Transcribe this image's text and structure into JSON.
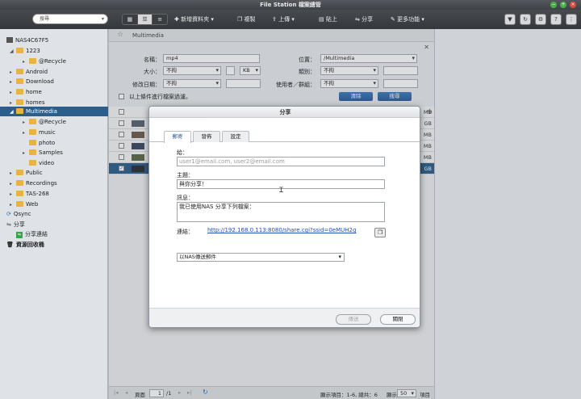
{
  "window": {
    "title": "File Station 檔案總管"
  },
  "toolbar": {
    "search_placeholder": "搜尋",
    "new_folder": "新增資料夾",
    "copy": "複製",
    "upload": "上傳",
    "paste": "貼上",
    "share": "分享",
    "more": "更多功能"
  },
  "sidebar": {
    "nas_name": "NAS4C67F5",
    "items": [
      {
        "label": "1223"
      },
      {
        "label": "@Recycle"
      },
      {
        "label": "Android"
      },
      {
        "label": "Download"
      },
      {
        "label": "home"
      },
      {
        "label": "homes"
      },
      {
        "label": "Multimedia"
      },
      {
        "label": "@Recycle"
      },
      {
        "label": "music"
      },
      {
        "label": "photo"
      },
      {
        "label": "Samples"
      },
      {
        "label": "video"
      },
      {
        "label": "Public"
      },
      {
        "label": "Recordings"
      },
      {
        "label": "TAS-268"
      },
      {
        "label": "Web"
      }
    ],
    "qsync": "Qsync",
    "share": "分享",
    "share_link": "分享連結",
    "recycle": "資源回收桶"
  },
  "path": {
    "current": "Multimedia"
  },
  "filter": {
    "name_label": "名稱：",
    "name_value": "mp4",
    "location_label": "位置：",
    "location_value": "/Multimedia",
    "size_label": "大小：",
    "size_value": "不拘",
    "size_unit": "KB",
    "type_label": "類別：",
    "type_value": "不拘",
    "modified_label": "修改日期：",
    "modified_value": "不拘",
    "owner_label": "使用者／群組：",
    "owner_value": "不拘",
    "clear_btn": "清除",
    "search_btn": "搜尋",
    "apply_label": "以上條件進行檔案過濾。"
  },
  "rows": [
    {
      "size": "MB"
    },
    {
      "size": "GB"
    },
    {
      "size": "MB"
    },
    {
      "size": "MB"
    },
    {
      "size": "MB"
    },
    {
      "size": "GB"
    }
  ],
  "pager": {
    "page_label": "頁面",
    "page_value": "1",
    "page_total": "/1",
    "display": "顯示項目：1-6, 總共：6",
    "show_label": "顯示",
    "show_value": "50",
    "items": "項目"
  },
  "dialog": {
    "title": "分享",
    "tabs": [
      "郵寄",
      "發佈",
      "設定"
    ],
    "to_label": "給：",
    "to_placeholder": "user1@email.com, user2@email.com",
    "subject_label": "主題：",
    "subject_value": "與你分享！",
    "message_label": "訊息：",
    "message_value": "我已使用NAS 分享下列檔案：",
    "link_label": "連結：",
    "link_value": "http://192.168.0.113:8080/share.cgi?ssid=0eMUH2g",
    "send_method": "以NAS傳送郵件",
    "send_btn": "傳送",
    "close_btn": "關閉"
  }
}
